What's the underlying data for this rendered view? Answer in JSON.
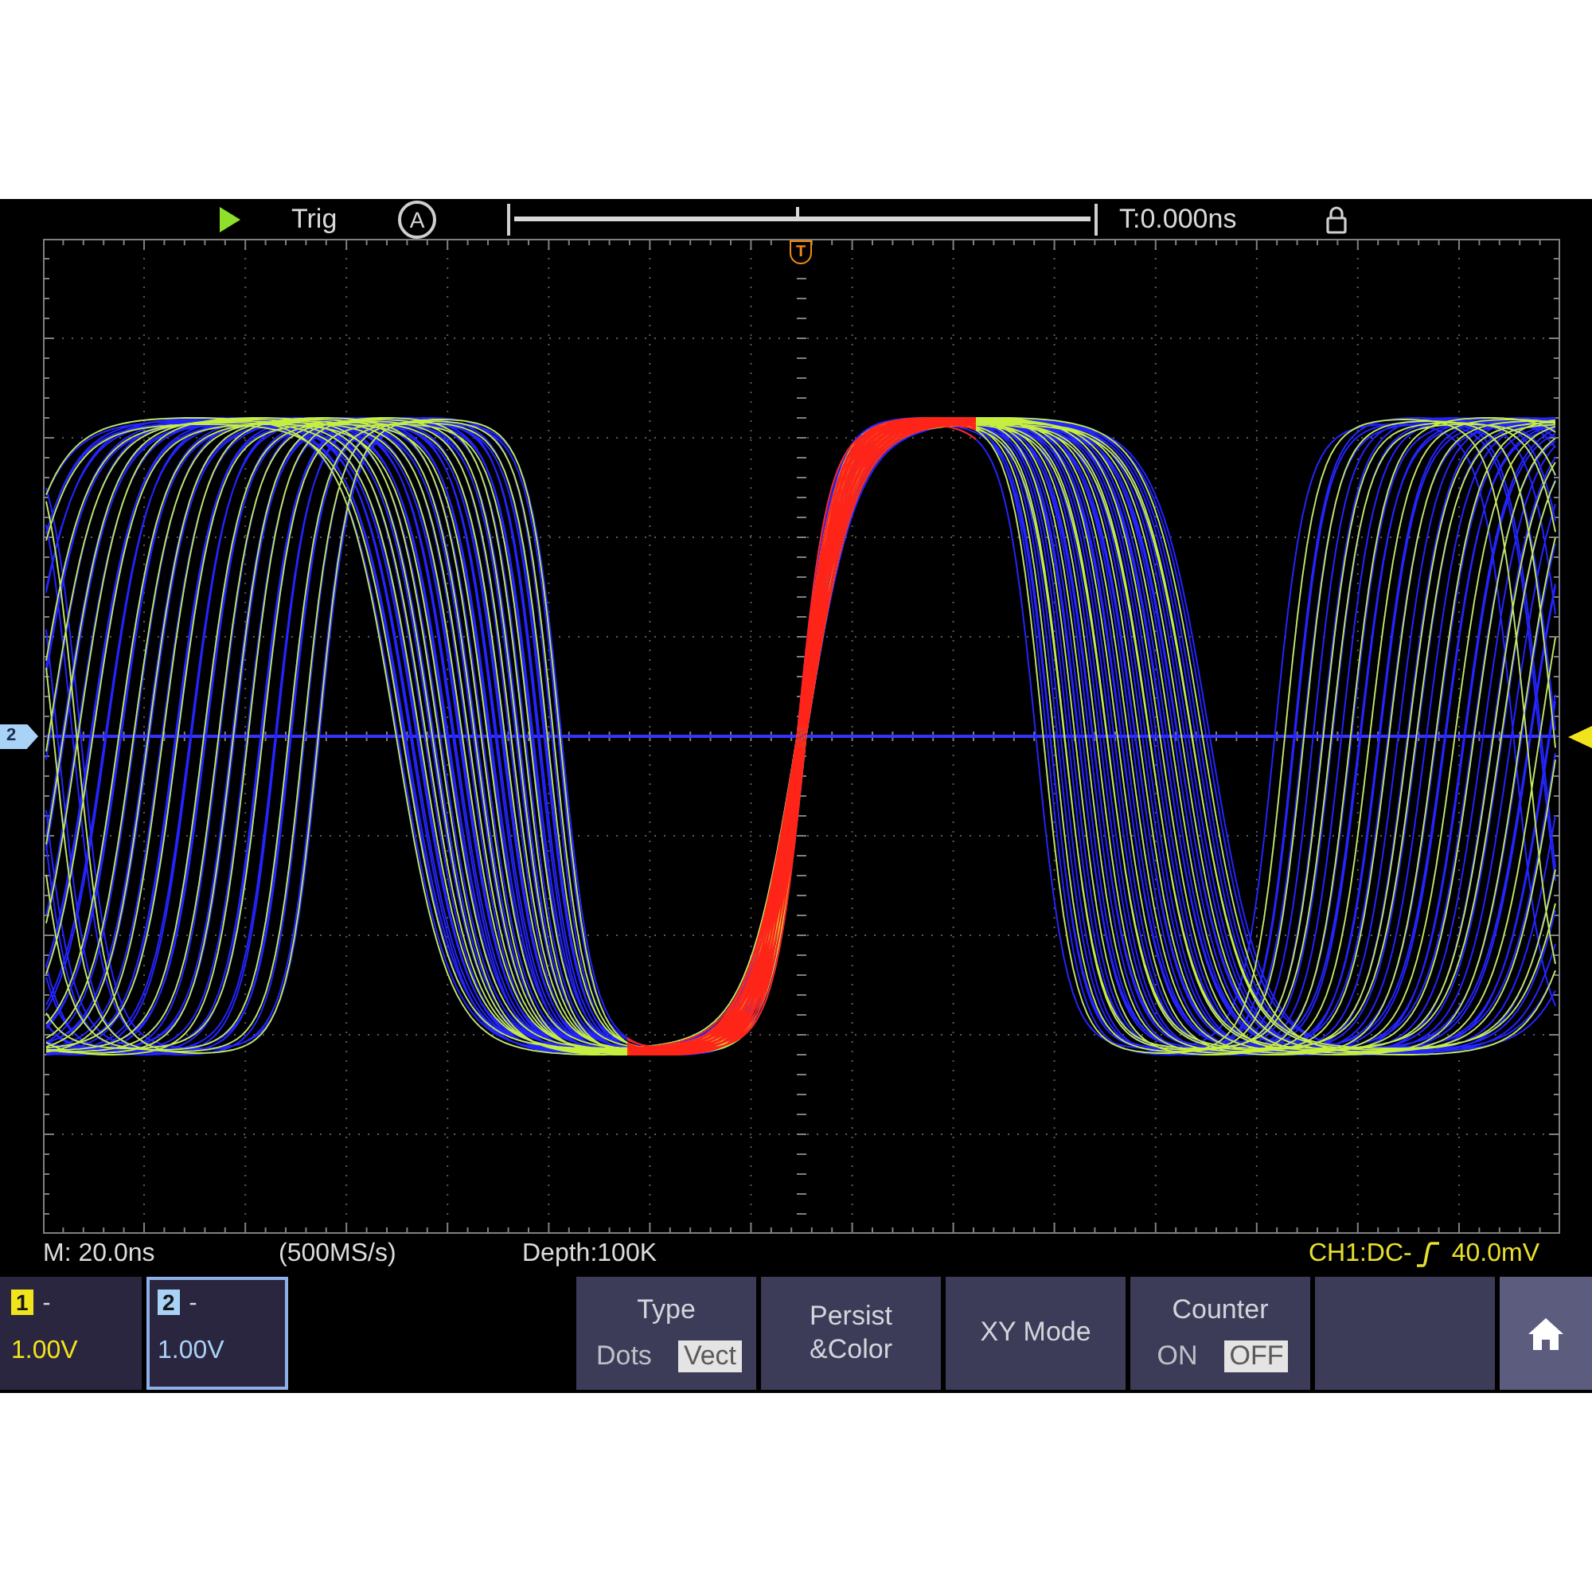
{
  "top_bar": {
    "trigger_label": "Trig",
    "trigger_mode": "A",
    "time_offset": "T:0.000ns"
  },
  "screen": {
    "channel_marker": "2",
    "trigger_position_marker": "T"
  },
  "status_line": {
    "timebase": "M: 20.0ns",
    "sample_rate": "(500MS/s)",
    "depth": "Depth:100K",
    "trigger_source": "CH1:DC-",
    "trigger_level": "40.0mV"
  },
  "channels": [
    {
      "number": "1",
      "coupling": "-",
      "scale": "1.00V",
      "color": "#f2e41c",
      "selected": false
    },
    {
      "number": "2",
      "coupling": "-",
      "scale": "1.00V",
      "color": "#a9d2f7",
      "selected": true
    }
  ],
  "menu": [
    {
      "kind": "toggle",
      "title": "Type",
      "options": [
        {
          "label": "Dots",
          "selected": false
        },
        {
          "label": "Vect",
          "selected": true
        }
      ]
    },
    {
      "kind": "button",
      "label": "Persist\n&Color"
    },
    {
      "kind": "button",
      "label": "XY Mode"
    },
    {
      "kind": "toggle",
      "title": "Counter",
      "options": [
        {
          "label": "ON",
          "selected": false
        },
        {
          "label": "OFF",
          "selected": true
        }
      ]
    },
    {
      "kind": "blank"
    },
    {
      "kind": "home"
    }
  ]
}
